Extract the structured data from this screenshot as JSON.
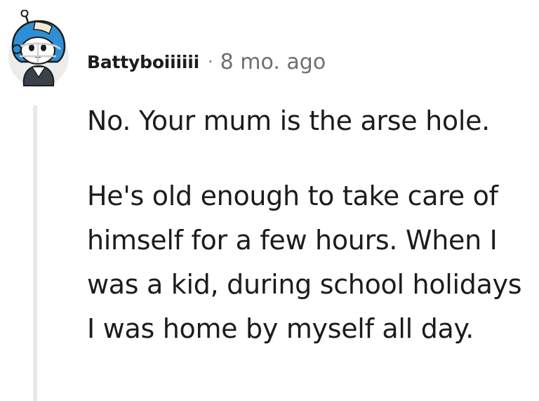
{
  "comment": {
    "username": "Battyboiiiiii",
    "separator": "·",
    "timestamp": "8 mo. ago",
    "paragraphs": [
      "No. Your mum is the arse hole.",
      "He's old enough to take care of himself for a few hours. When I was a kid, during school holidays I was home by myself all day."
    ],
    "avatar_icon": "football-helmet-snoo-avatar"
  }
}
